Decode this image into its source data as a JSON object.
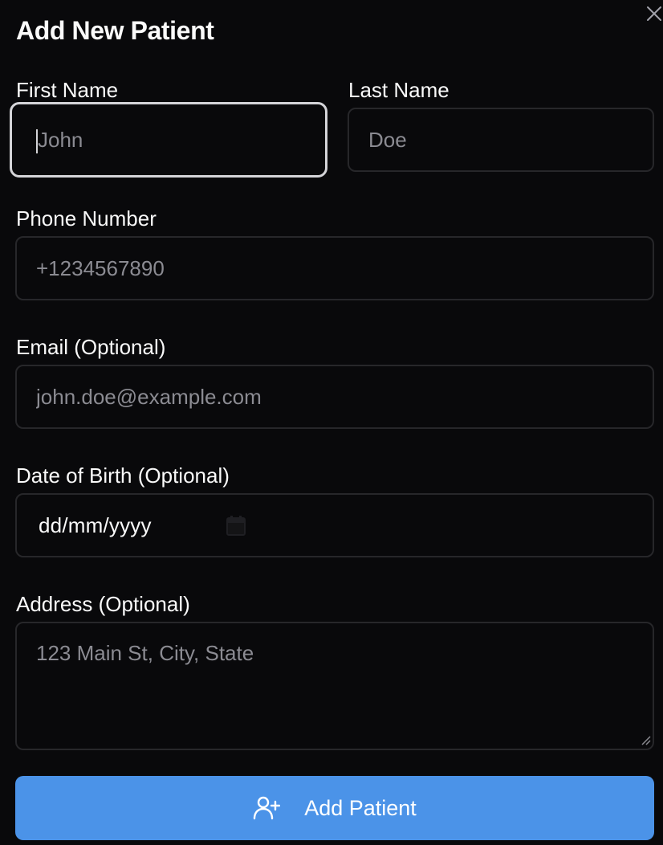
{
  "dialog": {
    "title": "Add New Patient",
    "close_icon": "close-icon"
  },
  "form": {
    "first_name": {
      "label": "First Name",
      "placeholder": "John",
      "value": ""
    },
    "last_name": {
      "label": "Last Name",
      "placeholder": "Doe",
      "value": ""
    },
    "phone": {
      "label": "Phone Number",
      "placeholder": "+1234567890",
      "value": ""
    },
    "email": {
      "label": "Email (Optional)",
      "placeholder": "john.doe@example.com",
      "value": ""
    },
    "dob": {
      "label": "Date of Birth (Optional)",
      "value": "dd/mm/yyyy",
      "icon": "calendar-icon"
    },
    "address": {
      "label": "Address (Optional)",
      "placeholder": "123 Main St, City, State",
      "value": ""
    }
  },
  "submit": {
    "label": "Add Patient",
    "icon": "user-plus-icon"
  },
  "colors": {
    "background": "#09090b",
    "border": "#27272a",
    "focus_ring": "#d4d4d8",
    "primary": "#4b93e8",
    "placeholder": "#8b8b92"
  }
}
